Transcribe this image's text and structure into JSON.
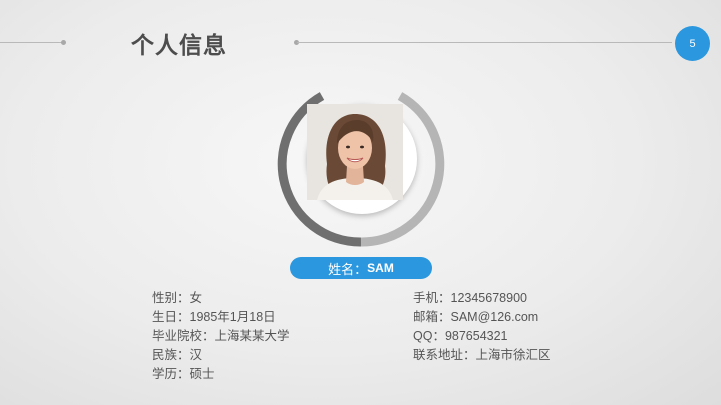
{
  "header": {
    "title": "个人信息",
    "page_number": "5"
  },
  "profile": {
    "name_label": "姓名：",
    "name_value": "SAM"
  },
  "info_left": [
    "性别：女",
    "生日：1985年1月18日",
    "毕业院校：上海某某大学",
    "民族：汉",
    "学历：硕士"
  ],
  "info_right": [
    "手机：12345678900",
    "邮箱：SAM@126.com",
    "QQ：987654321",
    "联系地址：上海市徐汇区"
  ],
  "colors": {
    "accent": "#2b97de",
    "title_text": "#4d4d4d",
    "body_text": "#555555",
    "ring_dark": "#6f6f6f",
    "ring_light": "#b5b5b5"
  }
}
